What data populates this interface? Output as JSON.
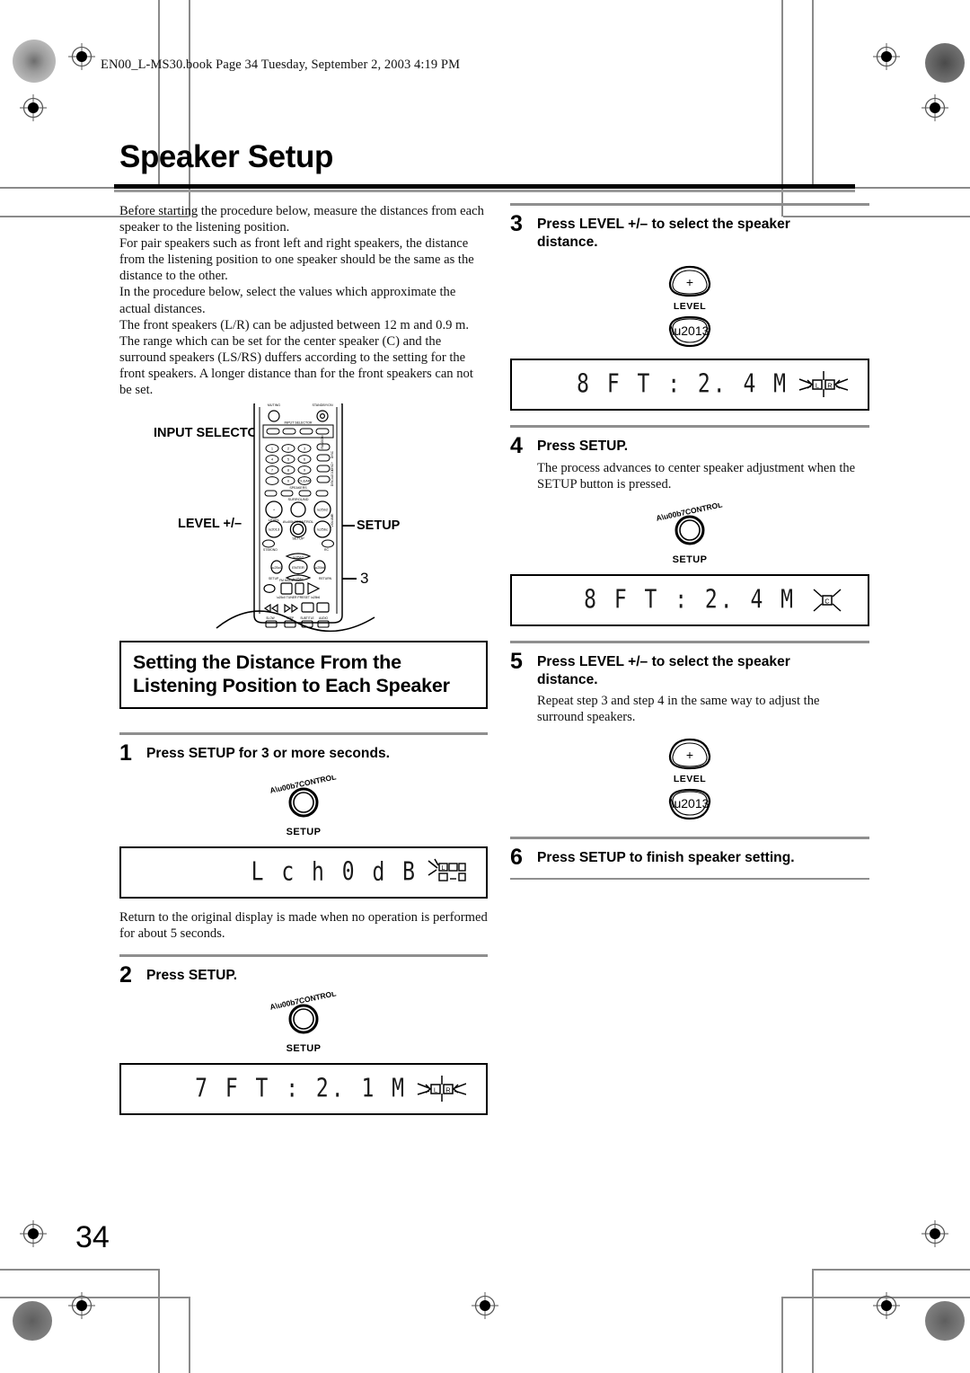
{
  "header": {
    "file_line": "EN00_L-MS30.book  Page 34  Tuesday, September 2, 2003  4:19 PM"
  },
  "page": {
    "title": "Speaker Setup",
    "number": "34"
  },
  "intro": {
    "paragraphs": [
      "Before starting the procedure below, measure the distances from each speaker to the listening position.",
      "For pair speakers such as front left and right speakers, the distance from the listening position to one speaker should be the same as the distance to the other.",
      "In the procedure below, select the values which approximate the actual distances.",
      "The front speakers (L/R) can be adjusted between 12 m and 0.9 m. The range which can be set for the center speaker (C) and the surround speakers (LS/RS) duffers according to the setting for the front speakers. A longer distance than for the front speakers can not be set."
    ]
  },
  "remote": {
    "callouts": {
      "input_selector": "INPUT SELECTOR",
      "level": "LEVEL +/–",
      "setup": "SETUP",
      "step_ref": "3"
    }
  },
  "section": {
    "heading_line1": "Setting the Distance From the",
    "heading_line2": "Listening Position to Each Speaker"
  },
  "controls": {
    "knob_top_label": "A·CONTROL",
    "knob_bottom_label": "SETUP",
    "level_label": "LEVEL",
    "plus": "+",
    "minus": "–"
  },
  "steps": [
    {
      "num": "1",
      "label": "Press SETUP for 3 or more seconds.",
      "note": "",
      "control": "knob",
      "display": {
        "text": "L c h     0 d B",
        "indicator": "grid-L"
      },
      "after_note": "Return to the original display is made when no operation is performed for about 5 seconds."
    },
    {
      "num": "2",
      "label": "Press SETUP.",
      "note": "",
      "control": "knob",
      "display": {
        "text": "7 F T  :  2. 1 M",
        "indicator": "LR-blink"
      },
      "after_note": ""
    },
    {
      "num": "3",
      "label": "Press LEVEL +/– to select the speaker distance.",
      "note": "",
      "control": "level",
      "display": {
        "text": "8 F T  :  2. 4 M",
        "indicator": "LR-blink"
      },
      "after_note": ""
    },
    {
      "num": "4",
      "label": "Press SETUP.",
      "note": "The process advances to center speaker adjustment when the SETUP button is pressed.",
      "control": "knob",
      "display": {
        "text": "8 F T  :  2. 4 M",
        "indicator": "C-blink"
      },
      "after_note": ""
    },
    {
      "num": "5",
      "label": "Press LEVEL +/– to select the speaker distance.",
      "note": "Repeat step 3 and step 4 in the same way to adjust the surround speakers.",
      "control": "level",
      "display": null,
      "after_note": ""
    },
    {
      "num": "6",
      "label": "Press SETUP to finish speaker setting.",
      "note": "",
      "control": null,
      "display": null,
      "after_note": ""
    }
  ]
}
